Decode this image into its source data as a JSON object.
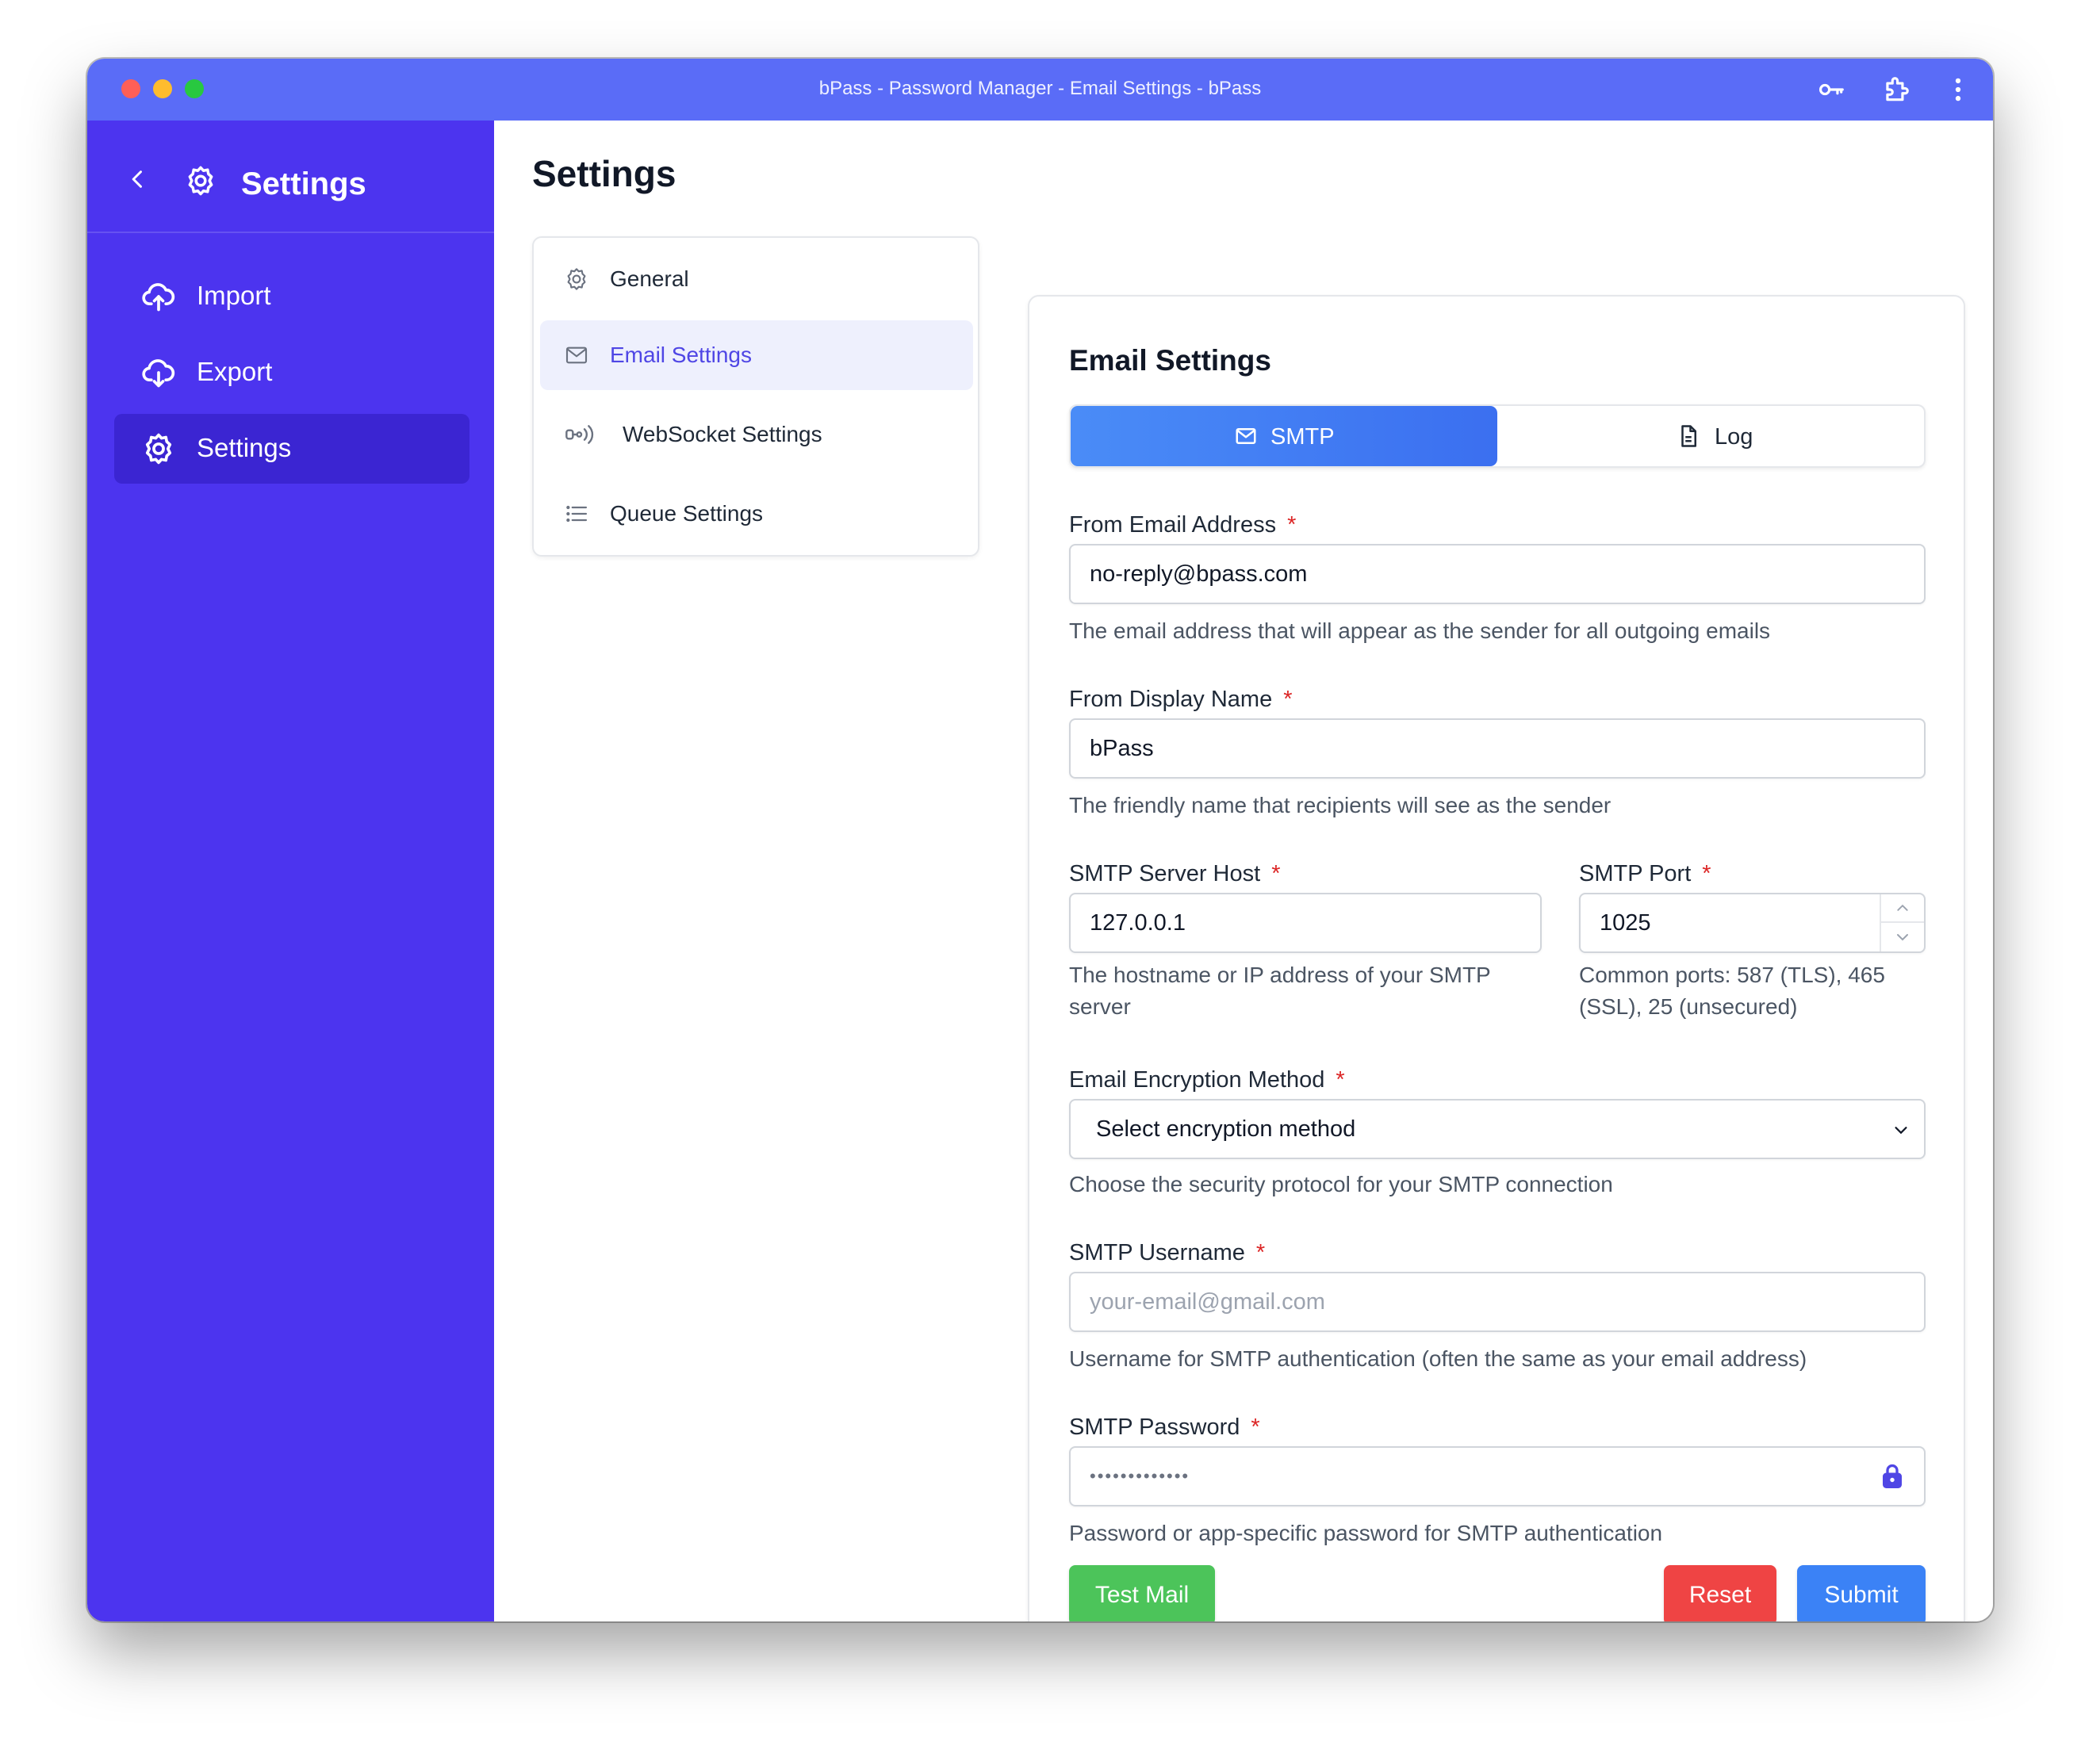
{
  "window": {
    "title": "bPass - Password Manager - Email Settings - bPass"
  },
  "sidebar": {
    "title": "Settings",
    "items": [
      {
        "label": "Import",
        "icon": "cloud-upload-icon"
      },
      {
        "label": "Export",
        "icon": "cloud-download-icon"
      },
      {
        "label": "Settings",
        "icon": "gear-icon",
        "active": true
      }
    ]
  },
  "main": {
    "title": "Settings"
  },
  "settings_nav": {
    "items": [
      {
        "label": "General",
        "icon": "gear-icon"
      },
      {
        "label": "Email Settings",
        "icon": "mail-icon",
        "active": true
      },
      {
        "label": "WebSocket Settings",
        "icon": "websocket-icon"
      },
      {
        "label": "Queue Settings",
        "icon": "list-icon"
      }
    ]
  },
  "email_settings": {
    "title": "Email Settings",
    "tabs": [
      {
        "label": "SMTP",
        "icon": "mail-icon",
        "active": true
      },
      {
        "label": "Log",
        "icon": "document-icon"
      }
    ],
    "fields": {
      "from_email": {
        "label": "From Email Address",
        "required": "*",
        "value": "no-reply@bpass.com",
        "help": "The email address that will appear as the sender for all outgoing emails"
      },
      "from_name": {
        "label": "From Display Name",
        "required": "*",
        "value": "bPass",
        "help": "The friendly name that recipients will see as the sender"
      },
      "smtp_host": {
        "label": "SMTP Server Host",
        "required": "*",
        "value": "127.0.0.1",
        "help": "The hostname or IP address of your SMTP server"
      },
      "smtp_port": {
        "label": "SMTP Port",
        "required": "*",
        "value": "1025",
        "help": "Common ports: 587 (TLS), 465 (SSL), 25 (unsecured)"
      },
      "encryption": {
        "label": "Email Encryption Method",
        "required": "*",
        "value": "Select encryption method",
        "help": "Choose the security protocol for your SMTP connection"
      },
      "smtp_username": {
        "label": "SMTP Username",
        "required": "*",
        "placeholder": "your-email@gmail.com",
        "help": "Username for SMTP authentication (often the same as your email address)"
      },
      "smtp_password": {
        "label": "SMTP Password",
        "required": "*",
        "value": "•••••••••••••",
        "help": "Password or app-specific password for SMTP authentication"
      }
    },
    "buttons": {
      "test": "Test Mail",
      "reset": "Reset",
      "submit": "Submit"
    }
  },
  "colors": {
    "sidebar": "#4c34ef",
    "sidebar_active": "#3b25d2",
    "titlebar": "#5a6cf7",
    "primary": "#3b82f6",
    "success": "#4cc45a",
    "danger": "#ef4444",
    "required": "#dc2626"
  }
}
